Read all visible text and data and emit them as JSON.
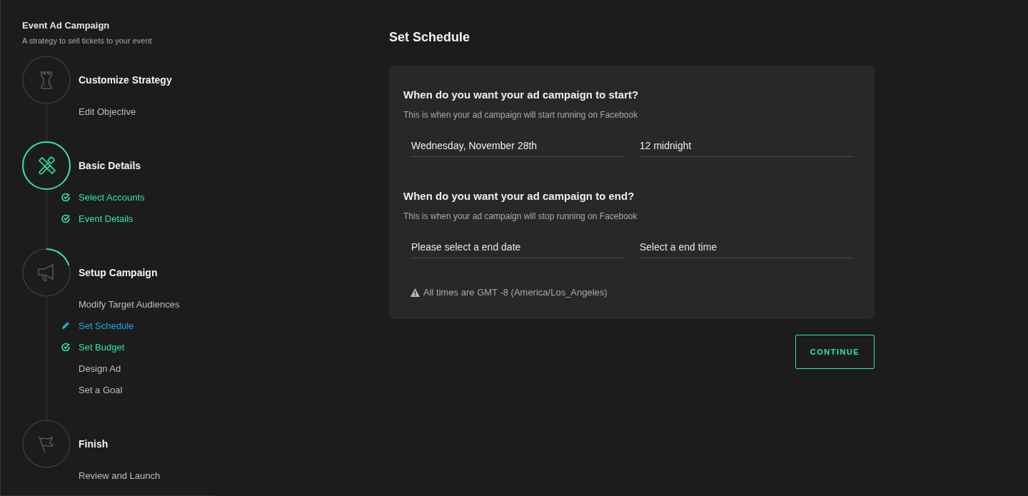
{
  "campaign": {
    "title": "Event Ad Campaign",
    "subtitle": "A strategy to sell tickets to your event"
  },
  "steps": [
    {
      "title": "Customize Strategy",
      "kind": "rook",
      "items": [
        {
          "label": "Edit Objective",
          "kind": "todo"
        }
      ]
    },
    {
      "title": "Basic Details",
      "kind": "tools",
      "level": 1,
      "items": [
        {
          "label": "Select Accounts",
          "kind": "done"
        },
        {
          "label": "Event Details",
          "kind": "done"
        }
      ]
    },
    {
      "title": "Setup Campaign",
      "kind": "megaphone",
      "level": 0.2,
      "items": [
        {
          "label": "Modify Target Audiences",
          "kind": "todo"
        },
        {
          "label": "Set Schedule",
          "kind": "current"
        },
        {
          "label": "Set Budget",
          "kind": "done"
        },
        {
          "label": "Design Ad",
          "kind": "todo"
        },
        {
          "label": "Set a Goal",
          "kind": "todo"
        }
      ]
    },
    {
      "title": "Finish",
      "kind": "flag",
      "items": [
        {
          "label": "Review and Launch",
          "kind": "todo"
        }
      ]
    }
  ],
  "page_title": "Set Schedule",
  "sections": [
    {
      "question": "When do you want your ad campaign to start?",
      "hint": "This is when your ad campaign will start running on Facebook",
      "date": {
        "value": "Wednesday, November 28th"
      },
      "time": {
        "value": "12 midnight"
      }
    },
    {
      "question": "When do you want your ad campaign to end?",
      "hint": "This is when your ad campaign will stop running on Facebook",
      "date": {
        "placeholder": "Please select a end date"
      },
      "time": {
        "placeholder": "Select a end time"
      }
    }
  ],
  "timezone_note": "All times are GMT -8 (America/Los_Angeles)",
  "continue_button": "CONTINUE"
}
